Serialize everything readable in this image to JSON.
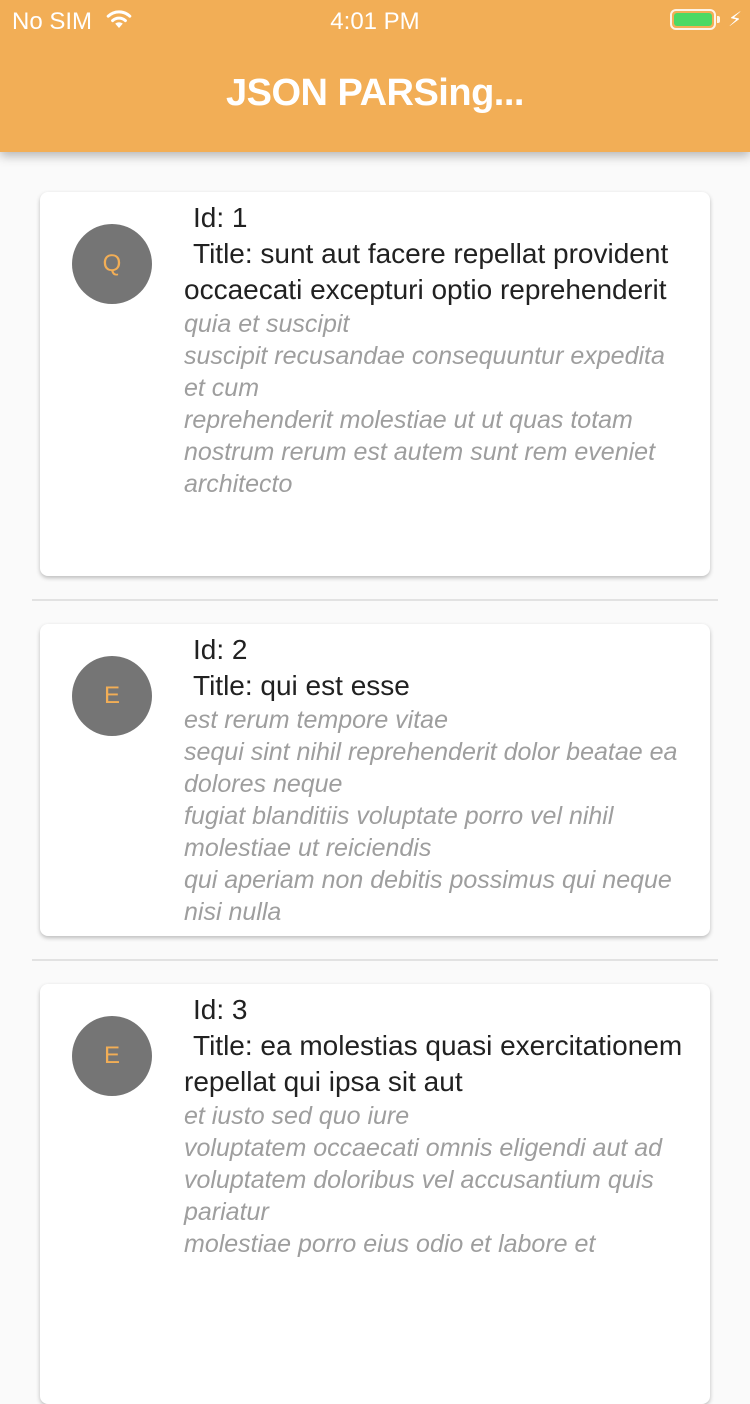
{
  "status_bar": {
    "carrier": "No SIM",
    "time": "4:01 PM",
    "wifi_icon": "wifi-icon",
    "battery_icon": "battery-icon",
    "charging_icon": "charging-bolt-icon",
    "battery_color": "#4cd964"
  },
  "app_bar": {
    "title": "JSON PARSing...",
    "background": "#f2ae56"
  },
  "posts": [
    {
      "avatar_letter": "Q",
      "id_label": "Id: 1",
      "title_label": "Title: sunt aut facere repellat provident occaecati excepturi optio reprehenderit",
      "body": "quia et suscipit\nsuscipit recusandae consequuntur expedita et cum\nreprehenderit molestiae ut ut quas totam\nnostrum rerum est autem sunt rem eveniet architecto"
    },
    {
      "avatar_letter": "E",
      "id_label": "Id: 2",
      "title_label": "Title: qui est esse",
      "body": "est rerum tempore vitae\nsequi sint nihil reprehenderit dolor beatae ea dolores neque\nfugiat blanditiis voluptate porro vel nihil molestiae ut reiciendis\nqui aperiam non debitis possimus qui neque nisi nulla"
    },
    {
      "avatar_letter": "E",
      "id_label": "Id: 3",
      "title_label": "Title: ea molestias quasi exercitationem repellat qui ipsa sit aut",
      "body": "et iusto sed quo iure\nvoluptatem occaecati omnis eligendi aut ad\nvoluptatem doloribus vel accusantium quis pariatur\nmolestiae porro eius odio et labore et"
    }
  ]
}
